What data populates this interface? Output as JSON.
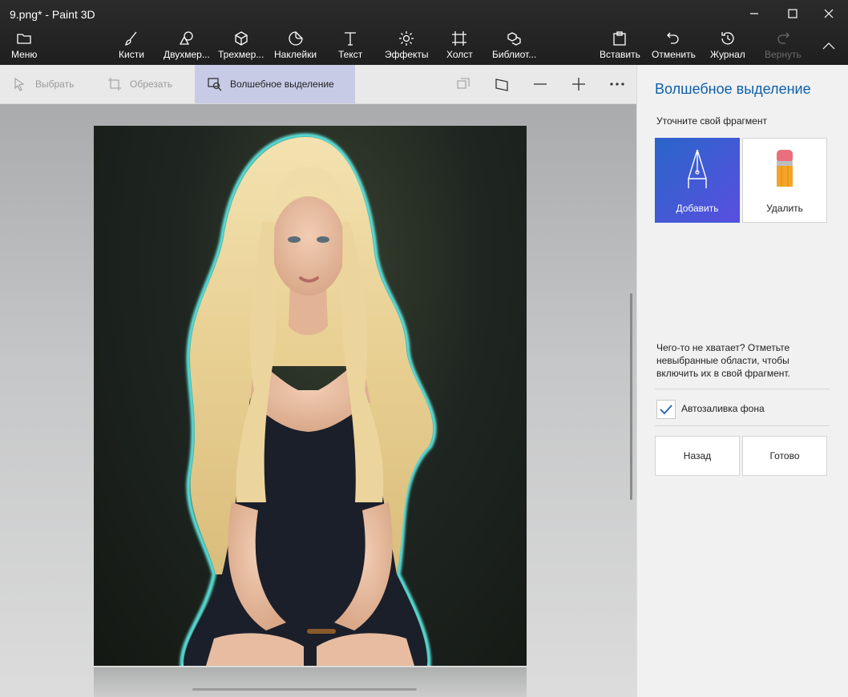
{
  "window": {
    "title": "9.png* - Paint 3D"
  },
  "toolbar": {
    "menu": "Меню",
    "brushes": "Кисти",
    "shapes2d": "Двухмер...",
    "shapes3d": "Трехмер...",
    "stickers": "Наклейки",
    "text": "Текст",
    "effects": "Эффекты",
    "canvas": "Холст",
    "library": "Библиот...",
    "paste": "Вставить",
    "undo": "Отменить",
    "history": "Журнал",
    "redo": "Вернуть"
  },
  "subtoolbar": {
    "select": "Выбрать",
    "crop": "Обрезать",
    "magic_select": "Волшебное выделение"
  },
  "panel": {
    "title": "Волшебное выделение",
    "subtitle": "Уточните свой фрагмент",
    "add": "Добавить",
    "remove": "Удалить",
    "hint": "Чего-то не хватает? Отметьте невыбранные области, чтобы включить их в свой фрагмент.",
    "autofill_label": "Автозаливка фона",
    "autofill_checked": true,
    "back": "Назад",
    "done": "Готово"
  },
  "colors": {
    "accent": "#0f5fa8",
    "active_gradient_start": "#2a65c9",
    "active_gradient_end": "#5a4fe0",
    "selection_outline": "#5ff0e8"
  }
}
